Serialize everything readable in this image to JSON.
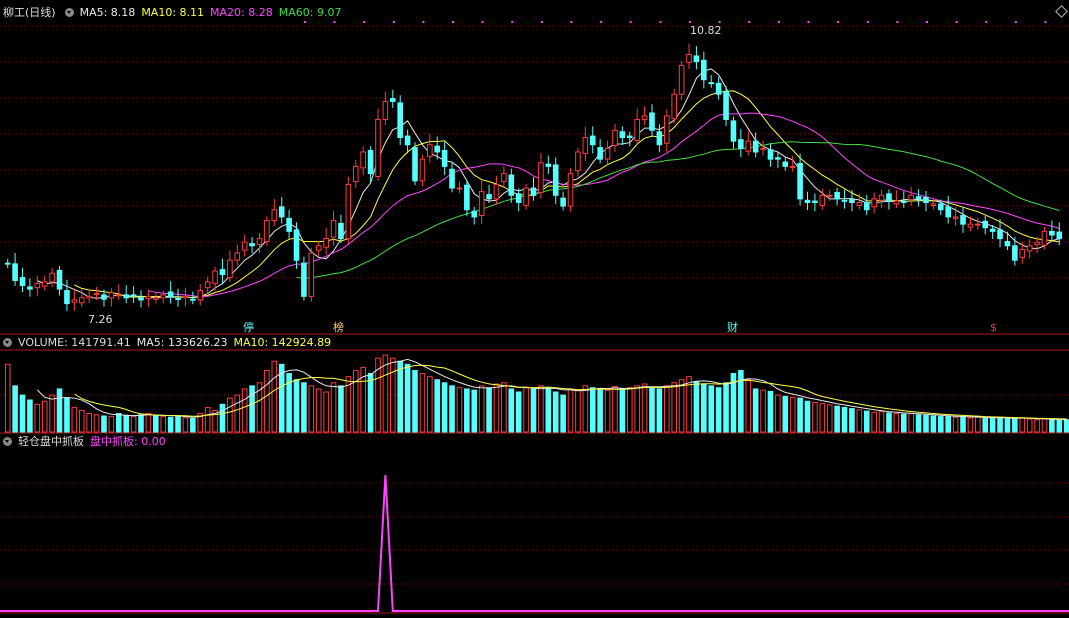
{
  "colors": {
    "up": "#ff3b3b",
    "down": "#54ffff",
    "ma5": "#e8e8e8",
    "ma10": "#ffff44",
    "ma20": "#ff44ff",
    "ma60": "#44dd44",
    "grid": "#7a1010",
    "frame": "#aa1a1a"
  },
  "header": {
    "title": "柳工(日线)",
    "ma5_label": "MA5: 8.18",
    "ma10_label": "MA10: 8.11",
    "ma20_label": "MA20: 8.28",
    "ma60_label": "MA60: 9.07"
  },
  "volume_header": {
    "label": "VOLUME: 141791.41",
    "ma5_label": "MA5: 133626.23",
    "ma10_label": "MA10: 142924.89"
  },
  "indicator_header": {
    "name": "轻仓盘中抓板",
    "value_label": "盘中抓板: 0.00"
  },
  "annotations": {
    "high_label": "10.82",
    "low_label": "7.26",
    "marker_1": "停",
    "marker_2": "榜",
    "marker_3": "财",
    "marker_4": "$"
  },
  "chart_data": [
    {
      "type": "candlestick",
      "high": 10.82,
      "low": 7.26,
      "ylim": [
        7.1,
        11.2
      ],
      "closes": [
        7.85,
        7.62,
        7.55,
        7.5,
        7.58,
        7.6,
        7.72,
        7.5,
        7.3,
        7.35,
        7.38,
        7.4,
        7.44,
        7.36,
        7.45,
        7.42,
        7.38,
        7.4,
        7.35,
        7.4,
        7.38,
        7.42,
        7.39,
        7.36,
        7.4,
        7.35,
        7.48,
        7.6,
        7.75,
        7.7,
        7.9,
        8.0,
        8.15,
        8.1,
        8.2,
        8.45,
        8.6,
        8.5,
        8.3,
        7.9,
        7.4,
        8.0,
        8.1,
        8.2,
        8.45,
        8.2,
        8.95,
        9.2,
        9.4,
        9.1,
        9.85,
        10.1,
        10.1,
        9.6,
        9.5,
        9.0,
        9.3,
        9.5,
        9.4,
        9.2,
        8.9,
        8.9,
        8.6,
        8.5,
        8.85,
        8.75,
        8.95,
        9.1,
        8.8,
        8.7,
        8.9,
        8.8,
        9.25,
        9.2,
        8.8,
        8.65,
        9.1,
        9.4,
        9.6,
        9.5,
        9.3,
        9.45,
        9.7,
        9.6,
        9.6,
        9.85,
        9.9,
        9.7,
        9.5,
        9.9,
        10.2,
        10.6,
        10.75,
        10.65,
        10.4,
        10.35,
        10.2,
        9.85,
        9.55,
        9.45,
        9.55,
        9.4,
        9.45,
        9.3,
        9.3,
        9.2,
        9.2,
        8.75,
        8.7,
        8.7,
        8.8,
        8.8,
        8.75,
        8.72,
        8.7,
        8.7,
        8.6,
        8.75,
        8.8,
        8.72,
        8.72,
        8.7,
        8.8,
        8.75,
        8.7,
        8.68,
        8.6,
        8.5,
        8.5,
        8.4,
        8.4,
        8.4,
        8.35,
        8.3,
        8.2,
        8.1,
        7.9,
        8.05,
        8.1,
        8.15,
        8.3,
        8.25,
        8.2
      ]
    },
    {
      "type": "bar",
      "name": "VOLUME",
      "value": 141791.41,
      "ma5": 133626.23,
      "ma10": 142924.89,
      "values": [
        110,
        75,
        60,
        52,
        45,
        50,
        60,
        70,
        55,
        40,
        35,
        30,
        28,
        26,
        25,
        30,
        27,
        25,
        28,
        30,
        27,
        25,
        24,
        26,
        23,
        22,
        30,
        40,
        35,
        45,
        55,
        60,
        70,
        75,
        80,
        100,
        115,
        110,
        95,
        85,
        80,
        75,
        70,
        65,
        80,
        75,
        90,
        100,
        105,
        95,
        120,
        125,
        120,
        115,
        110,
        100,
        95,
        90,
        85,
        80,
        75,
        72,
        70,
        68,
        75,
        72,
        78,
        80,
        70,
        65,
        72,
        70,
        75,
        72,
        65,
        60,
        70,
        68,
        75,
        72,
        70,
        68,
        74,
        70,
        72,
        75,
        78,
        72,
        70,
        75,
        80,
        85,
        90,
        82,
        78,
        75,
        72,
        80,
        95,
        100,
        85,
        70,
        68,
        66,
        60,
        58,
        56,
        55,
        50,
        48,
        46,
        44,
        42,
        40,
        38,
        36,
        34,
        32,
        33,
        31,
        30,
        29,
        30,
        28,
        27,
        26,
        25,
        26,
        24,
        25,
        23,
        24,
        22,
        23,
        24,
        21,
        22,
        23,
        21,
        20,
        21,
        20,
        19,
        20
      ]
    },
    {
      "type": "line",
      "name": "盘中抓板",
      "value": 0.0,
      "ylim": [
        0,
        1.2
      ],
      "spike_index": 51,
      "spike_value": 1.0
    }
  ]
}
